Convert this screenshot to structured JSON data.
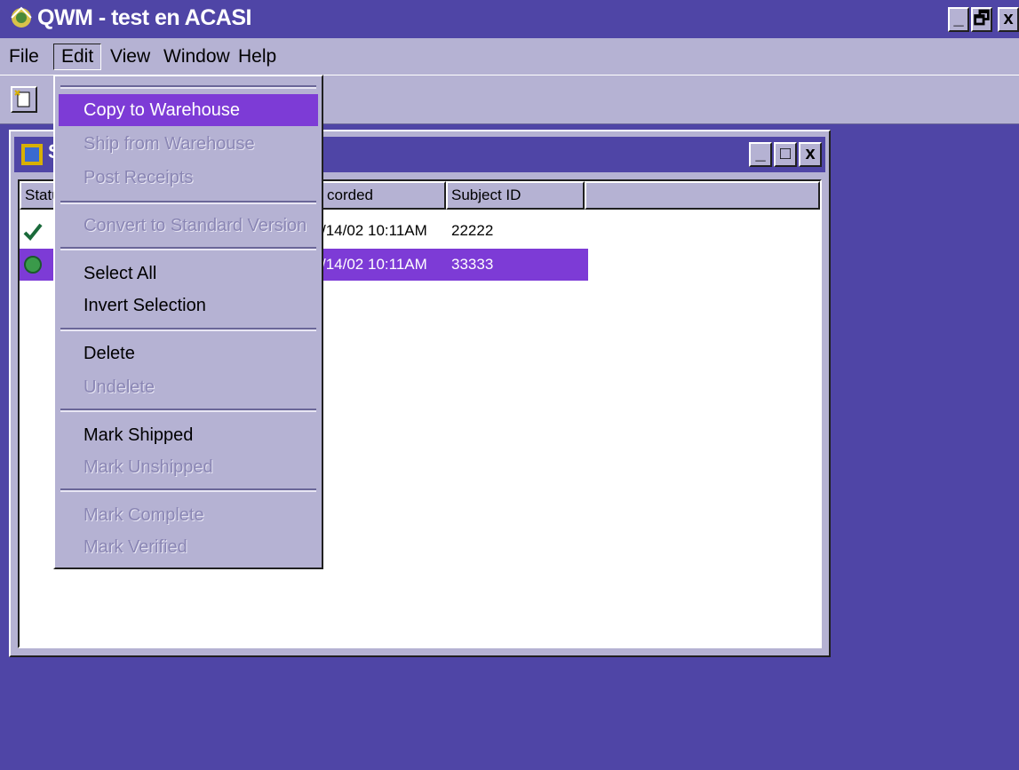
{
  "window": {
    "title": "QWM - test en ACASI",
    "controls": {
      "minimize": "_",
      "restore": "🗗",
      "close": "x"
    }
  },
  "menubar": {
    "items": [
      {
        "label": "File"
      },
      {
        "label": "Edit"
      },
      {
        "label": "View"
      },
      {
        "label": "Window"
      },
      {
        "label": "Help"
      }
    ]
  },
  "child_window": {
    "title_initial": "S",
    "controls": {
      "minimize": "_",
      "maximize": "□",
      "close": "x"
    },
    "columns": [
      "Statu",
      "",
      "corded",
      "Subject ID"
    ],
    "rows": [
      {
        "status_icon": "checkmark-icon",
        "recorded": "/14/02 10:11AM",
        "subject_id": "22222",
        "selected": false
      },
      {
        "status_icon": "green-circle-icon",
        "recorded": "/14/02 10:11AM",
        "subject_id": "33333",
        "selected": true
      }
    ]
  },
  "edit_menu": {
    "items": [
      {
        "label": "Copy to Warehouse",
        "enabled": true,
        "highlighted": true
      },
      {
        "label": "Ship from Warehouse",
        "enabled": false
      },
      {
        "label": "Post Receipts",
        "enabled": false
      },
      {
        "label": "Convert to Standard Version",
        "enabled": false
      },
      {
        "label": "Select All",
        "enabled": true
      },
      {
        "label": "Invert Selection",
        "enabled": true
      },
      {
        "label": "Delete",
        "enabled": true
      },
      {
        "label": "Undelete",
        "enabled": false
      },
      {
        "label": "Mark Shipped",
        "enabled": true
      },
      {
        "label": "Mark Unshipped",
        "enabled": false
      },
      {
        "label": "Mark Complete",
        "enabled": false
      },
      {
        "label": "Mark Verified",
        "enabled": false
      }
    ]
  },
  "colors": {
    "desktop": "#4f45a6",
    "chrome": "#b5b2d3",
    "highlight": "#7d3bd6",
    "disabled_text": "#8a86b4"
  }
}
